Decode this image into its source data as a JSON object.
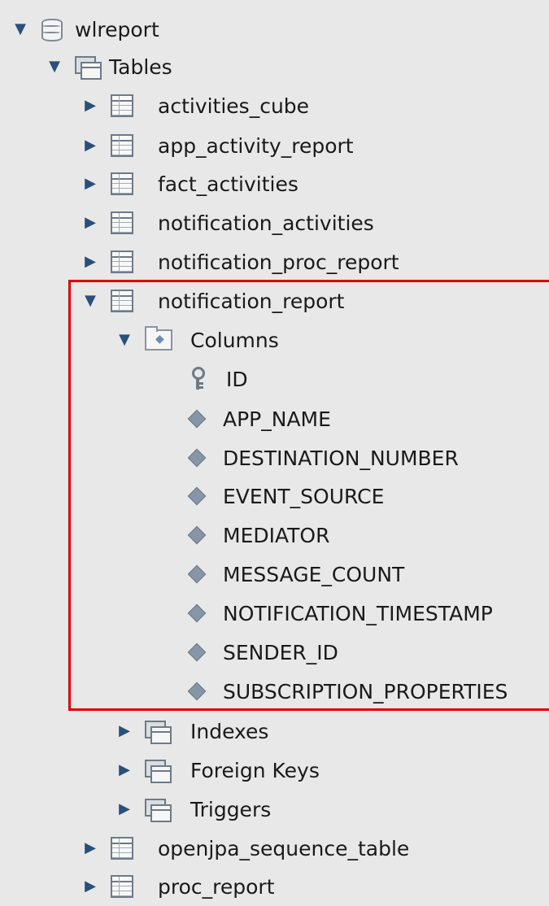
{
  "root": {
    "label": "wlreport",
    "icon": "database-icon",
    "expanded": true
  },
  "tables_folder": {
    "label": "Tables",
    "icon": "tables-folder-icon",
    "expanded": true
  },
  "tables_before": [
    {
      "label": "activities_cube"
    },
    {
      "label": "app_activity_report"
    },
    {
      "label": "fact_activities"
    },
    {
      "label": "notification_activities"
    },
    {
      "label": "notification_proc_report"
    }
  ],
  "selected_table": {
    "label": "notification_report",
    "expanded": true,
    "columns_folder": {
      "label": "Columns",
      "expanded": true
    },
    "columns": [
      {
        "label": "ID",
        "icon": "primary-key-icon"
      },
      {
        "label": "APP_NAME",
        "icon": "column-icon"
      },
      {
        "label": "DESTINATION_NUMBER",
        "icon": "column-icon"
      },
      {
        "label": "EVENT_SOURCE",
        "icon": "column-icon"
      },
      {
        "label": "MEDIATOR",
        "icon": "column-icon"
      },
      {
        "label": "MESSAGE_COUNT",
        "icon": "column-icon"
      },
      {
        "label": "NOTIFICATION_TIMESTAMP",
        "icon": "column-icon"
      },
      {
        "label": "SENDER_ID",
        "icon": "column-icon"
      },
      {
        "label": "SUBSCRIPTION_PROPERTIES",
        "icon": "column-icon"
      }
    ],
    "subfolders": [
      {
        "label": "Indexes",
        "icon": "indexes-folder-icon"
      },
      {
        "label": "Foreign Keys",
        "icon": "foreign-keys-folder-icon"
      },
      {
        "label": "Triggers",
        "icon": "triggers-folder-icon"
      }
    ]
  },
  "tables_after": [
    {
      "label": "openjpa_sequence_table"
    },
    {
      "label": "proc_report"
    }
  ],
  "colors": {
    "highlight_border": "#e00000",
    "background": "#e8e8e8",
    "arrow": "#2a4f7a"
  }
}
